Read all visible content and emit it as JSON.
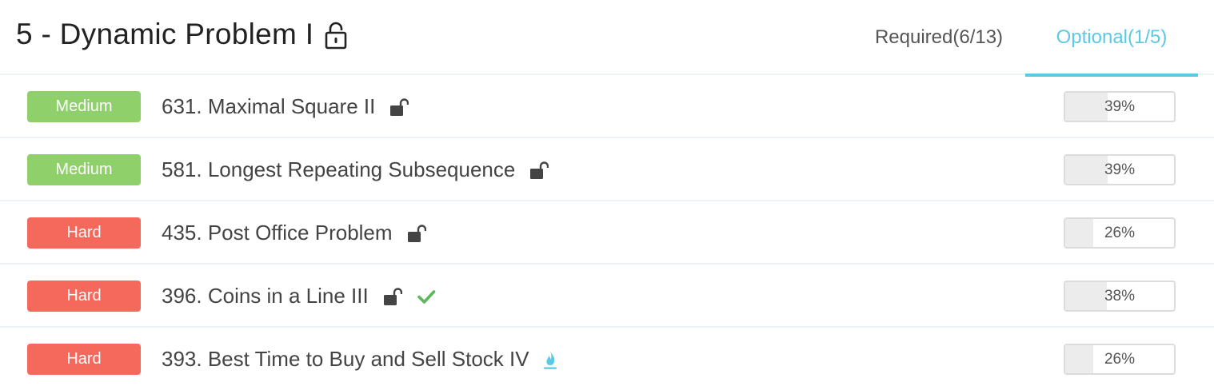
{
  "header": {
    "title": "5 - Dynamic Problem I",
    "title_icon": "padlock-icon"
  },
  "tabs": [
    {
      "label": "Required(6/13)",
      "active": false
    },
    {
      "label": "Optional(1/5)",
      "active": true
    }
  ],
  "colors": {
    "accent": "#5bc8e6",
    "medium": "#8fd06a",
    "hard": "#f5685c",
    "check": "#5cb85c"
  },
  "problems": [
    {
      "difficulty": "Medium",
      "title": "631. Maximal Square II",
      "icon": "unlock-icon",
      "solved": false,
      "progress": "39%",
      "progress_value": 0.39
    },
    {
      "difficulty": "Medium",
      "title": "581. Longest Repeating Subsequence",
      "icon": "unlock-icon",
      "solved": false,
      "progress": "39%",
      "progress_value": 0.39
    },
    {
      "difficulty": "Hard",
      "title": "435. Post Office Problem",
      "icon": "unlock-icon",
      "solved": false,
      "progress": "26%",
      "progress_value": 0.26
    },
    {
      "difficulty": "Hard",
      "title": "396. Coins in a Line III",
      "icon": "unlock-icon",
      "solved": true,
      "progress": "38%",
      "progress_value": 0.38
    },
    {
      "difficulty": "Hard",
      "title": "393. Best Time to Buy and Sell Stock IV",
      "icon": "flame-icon",
      "solved": false,
      "progress": "26%",
      "progress_value": 0.26
    }
  ]
}
